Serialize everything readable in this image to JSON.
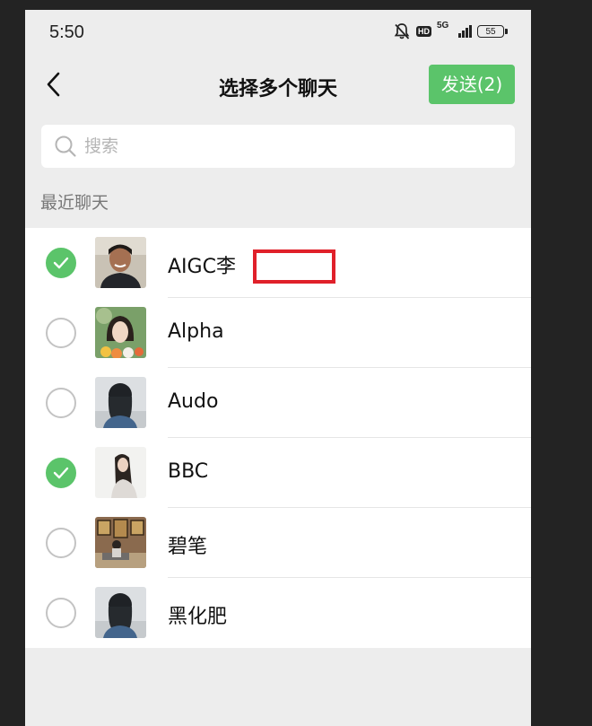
{
  "status_bar": {
    "time": "5:50",
    "hd_label": "HD",
    "network_label": "5G",
    "battery_level": "55"
  },
  "header": {
    "title": "选择多个聊天",
    "send_label": "发送(2)"
  },
  "search": {
    "placeholder": "搜索"
  },
  "section_title": "最近聊天",
  "chats": [
    {
      "name": "AIGC李",
      "selected": true
    },
    {
      "name": "Alpha",
      "selected": false
    },
    {
      "name": "Audo",
      "selected": false
    },
    {
      "name": "BBC",
      "selected": true
    },
    {
      "name": "碧笔",
      "selected": false
    },
    {
      "name": "黑化肥",
      "selected": false
    }
  ],
  "colors": {
    "accent": "#5bc46a",
    "annotation_red": "#e0202a",
    "background": "#ededed"
  }
}
